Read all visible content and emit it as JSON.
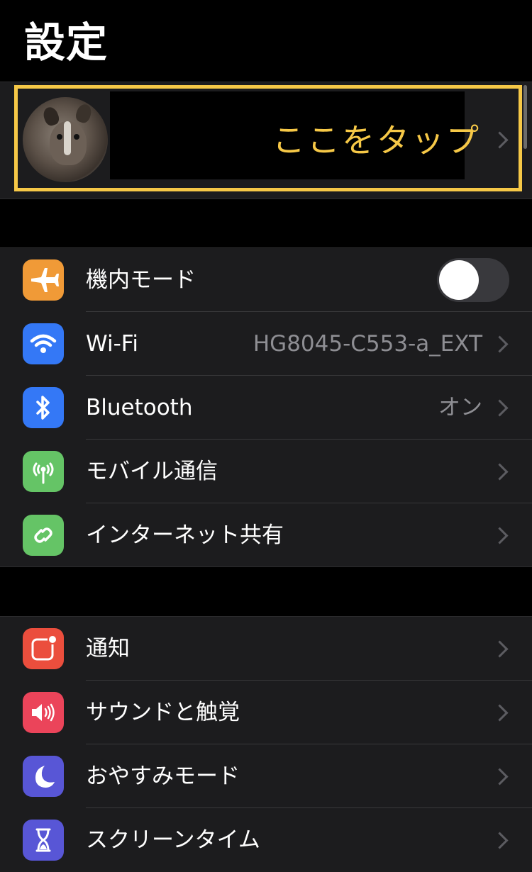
{
  "header": {
    "title": "設定"
  },
  "profile": {
    "callout_text": "ここをタップ"
  },
  "connectivity": [
    {
      "label": "機内モード",
      "icon": "airplane-icon",
      "color": "#f09a37",
      "toggle_on": false
    },
    {
      "label": "Wi-Fi",
      "icon": "wifi-icon",
      "color": "#3478f6",
      "value": "HG8045-C553-a_EXT"
    },
    {
      "label": "Bluetooth",
      "icon": "bluetooth-icon",
      "color": "#3478f6",
      "value": "オン"
    },
    {
      "label": "モバイル通信",
      "icon": "antenna-icon",
      "color": "#65c466"
    },
    {
      "label": "インターネット共有",
      "icon": "hotspot-icon",
      "color": "#65c466"
    }
  ],
  "notifications": [
    {
      "label": "通知",
      "icon": "notifications-icon",
      "color": "#eb4e3d"
    },
    {
      "label": "サウンドと触覚",
      "icon": "speaker-icon",
      "color": "#eb445a"
    },
    {
      "label": "おやすみモード",
      "icon": "moon-icon",
      "color": "#5856d6"
    },
    {
      "label": "スクリーンタイム",
      "icon": "hourglass-icon",
      "color": "#5856d6"
    }
  ],
  "colors": {
    "background": "#000000",
    "cell": "#1c1c1e",
    "highlight": "#f6c847"
  }
}
